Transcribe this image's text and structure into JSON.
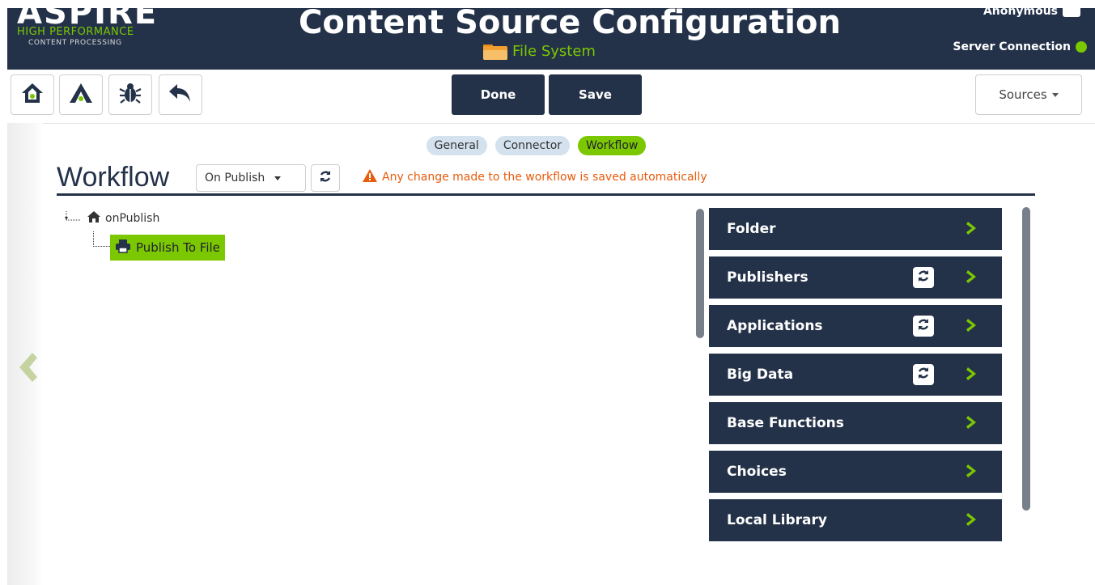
{
  "header": {
    "logo": {
      "brand": "ASPIRE",
      "tagline_top": "HIGH PERFORMANCE",
      "tagline_bottom": "CONTENT PROCESSING"
    },
    "title": "Content Source Configuration",
    "subtitle": "File System",
    "user": "Anonymous",
    "server_status": "Server Connection",
    "server_status_color": "#7bc800"
  },
  "toolbar": {
    "icons": [
      "home-icon",
      "aspire-logo-icon",
      "bug-icon",
      "undo-icon"
    ],
    "done_label": "Done",
    "save_label": "Save",
    "sources_label": "Sources"
  },
  "tabs": [
    {
      "label": "General",
      "active": false
    },
    {
      "label": "Connector",
      "active": false
    },
    {
      "label": "Workflow",
      "active": true
    }
  ],
  "workflow": {
    "heading": "Workflow",
    "event_select": "On Publish",
    "warning": "Any change made to the workflow is saved automatically",
    "tree": {
      "root": "onPublish",
      "children": [
        "Publish To File"
      ]
    }
  },
  "palette": {
    "items": [
      {
        "label": "Folder",
        "refresh": false
      },
      {
        "label": "Publishers",
        "refresh": true
      },
      {
        "label": "Applications",
        "refresh": true
      },
      {
        "label": "Big Data",
        "refresh": true
      },
      {
        "label": "Base Functions",
        "refresh": false
      },
      {
        "label": "Choices",
        "refresh": false
      },
      {
        "label": "Local Library",
        "refresh": false
      }
    ]
  },
  "colors": {
    "navy": "#243249",
    "accent_green": "#7bc800",
    "warning_orange": "#e85b0c",
    "tab_inactive": "#d3e2ee"
  }
}
